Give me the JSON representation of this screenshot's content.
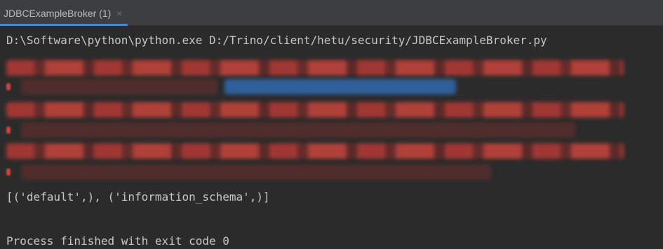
{
  "tab": {
    "title": "JDBCExampleBroker (1)",
    "close_glyph": "×"
  },
  "console": {
    "command": "D:\\Software\\python\\python.exe D:/Trino/client/hetu/security/JDBCExampleBroker.py",
    "result": "[('default',), ('information_schema',)]",
    "exit_message": "Process finished with exit code 0"
  },
  "colors": {
    "background": "#2b2b2b",
    "tabbar": "#3c3f41",
    "tab_underline": "#4a88c7",
    "text": "#c7c7c7",
    "error_text": "#d0443e",
    "link": "#2f5f9a"
  }
}
